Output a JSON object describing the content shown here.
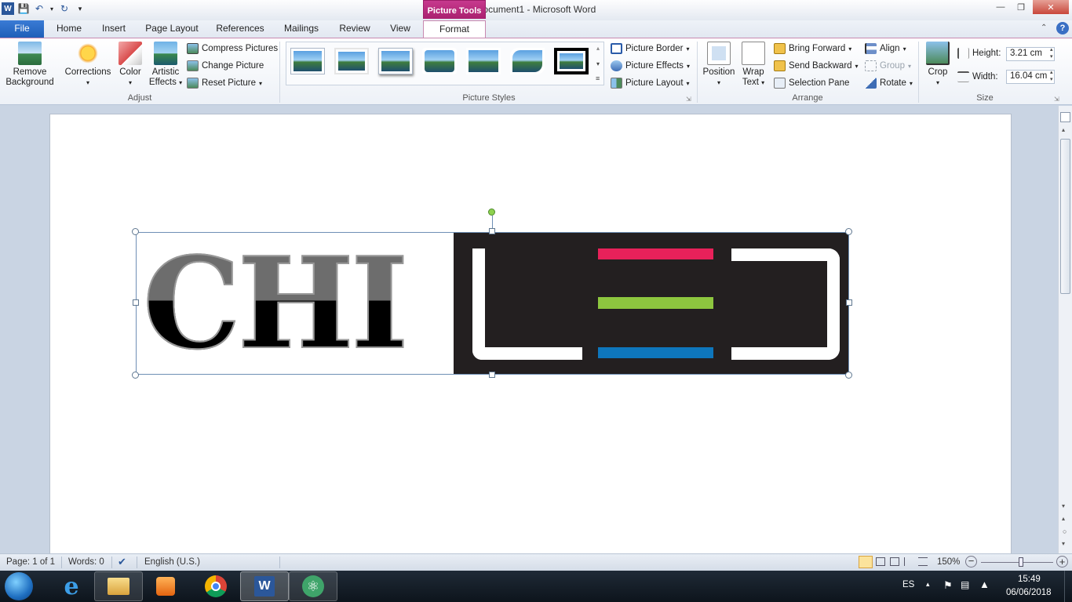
{
  "window": {
    "title": "Document1  -  Microsoft Word",
    "contextual_tab_group": "Picture Tools"
  },
  "tabs": [
    "File",
    "Home",
    "Insert",
    "Page Layout",
    "References",
    "Mailings",
    "Review",
    "View",
    "Format"
  ],
  "ribbon": {
    "adjust": {
      "label": "Adjust",
      "remove_background": [
        "Remove",
        "Background"
      ],
      "corrections": "Corrections",
      "color": "Color",
      "artistic_effects": [
        "Artistic",
        "Effects"
      ],
      "compress_pictures": "Compress Pictures",
      "change_picture": "Change Picture",
      "reset_picture": "Reset Picture"
    },
    "picture_styles": {
      "label": "Picture Styles",
      "picture_border": "Picture Border",
      "picture_effects": "Picture Effects",
      "picture_layout": "Picture Layout"
    },
    "arrange": {
      "label": "Arrange",
      "position": "Position",
      "wrap_text": [
        "Wrap",
        "Text"
      ],
      "bring_forward": "Bring Forward",
      "send_backward": "Send Backward",
      "selection_pane": "Selection Pane",
      "align": "Align",
      "group": "Group",
      "rotate": "Rotate"
    },
    "size": {
      "label": "Size",
      "crop": "Crop",
      "height_label": "Height:",
      "height_value": "3.21 cm",
      "width_label": "Width:",
      "width_value": "16.04 cm"
    }
  },
  "document": {
    "logo_text": "CHI"
  },
  "status": {
    "page": "Page: 1 of 1",
    "words": "Words: 0",
    "language": "English (U.S.)",
    "zoom": "150%"
  },
  "taskbar": {
    "language": "ES",
    "time": "15:49",
    "date": "06/06/2018"
  },
  "colors": {
    "led_red": "#e8215a",
    "led_green": "#8dc63f",
    "led_blue": "#0e76bc",
    "logo_dark": "#231f20"
  }
}
